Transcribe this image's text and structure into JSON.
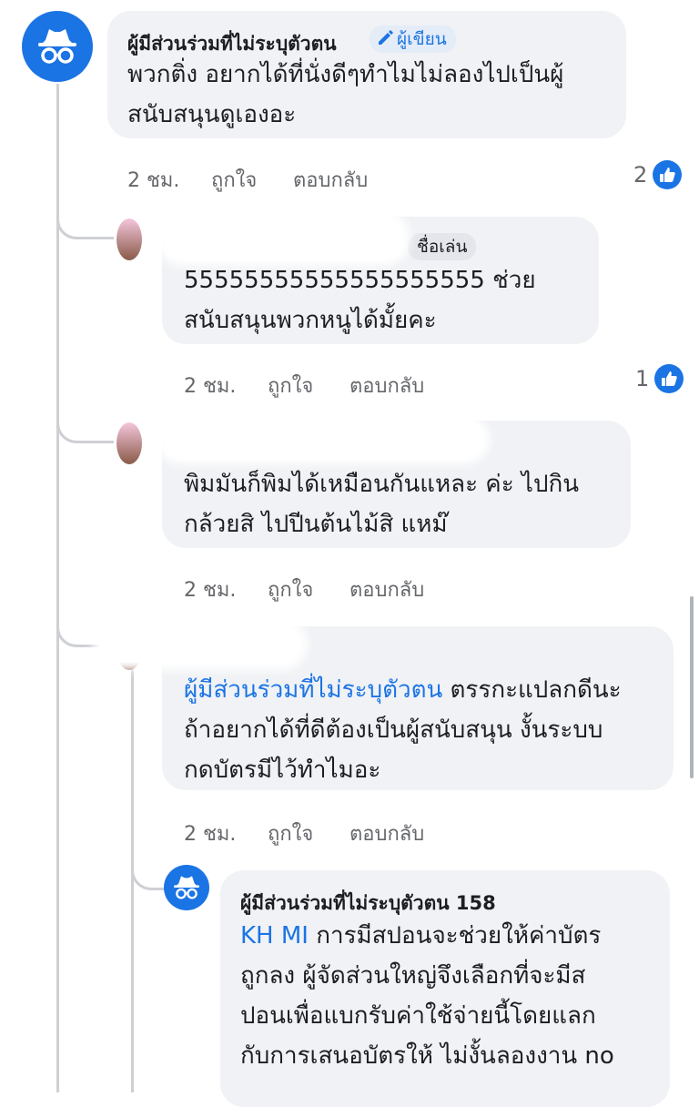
{
  "comments": [
    {
      "author": "ผู้มีส่วนร่วมที่ไม่ระบุตัวตน",
      "badge": "ผู้เขียน",
      "lines": [
        "พวกติ่ง อยากได้ที่นั่งดีๆทำไมไม่ลองไปเป็นผู้",
        "สนับสนุนดูเองอะ"
      ],
      "time": "2 ชม.",
      "like_label": "ถูกใจ",
      "reply_label": "ตอบกลับ",
      "reaction_count": "2"
    },
    {
      "badge": "ชื่อเล่น",
      "lines": [
        "55555555555555555555 ช่วย",
        "สนับสนุนพวกหนูได้มั้ยคะ"
      ],
      "time": "2 ชม.",
      "like_label": "ถูกใจ",
      "reply_label": "ตอบกลับ",
      "reaction_count": "1"
    },
    {
      "lines": [
        "พิมมันก็พิมได้เหมือนกันแหละ ค่ะ ไปกิน",
        "กล้วยสิ ไปปีนต้นไม้สิ แหม๊"
      ],
      "time": "2 ชม.",
      "like_label": "ถูกใจ",
      "reply_label": "ตอบกลับ"
    },
    {
      "mention": "ผู้มีส่วนร่วมที่ไม่ระบุตัวตน",
      "first_line_rest": " ตรรกะแปลกดีนะ",
      "lines": [
        "ถ้าอยากได้ที่ดีต้องเป็นผู้สนับสนุน งั้นระบบ",
        "กดบัตรมีไว้ทำไมอะ"
      ],
      "time": "2 ชม.",
      "like_label": "ถูกใจ",
      "reply_label": "ตอบกลับ"
    },
    {
      "author": "ผู้มีส่วนร่วมที่ไม่ระบุตัวตน 158",
      "mention": "KH MI",
      "first_line_rest": " การมีสปอนจะช่วยให้ค่าบัตร",
      "lines": [
        "ถูกลง ผู้จัดส่วนใหญ่จึงเลือกที่จะมีส",
        "ปอนเพื่อแบกรับค่าใช้จ่ายนี้โดยแลก",
        "กับการเสนอบัตรให้ ไม่งั้นลองงาน no"
      ]
    }
  ],
  "icons": {
    "anonymous_avatar": "incognito-icon",
    "author_badge": "pencil-icon",
    "reaction": "like-icon"
  },
  "colors": {
    "accent": "#1b74e4",
    "bubble": "#f0f2f5",
    "meta_text": "#65676b"
  }
}
